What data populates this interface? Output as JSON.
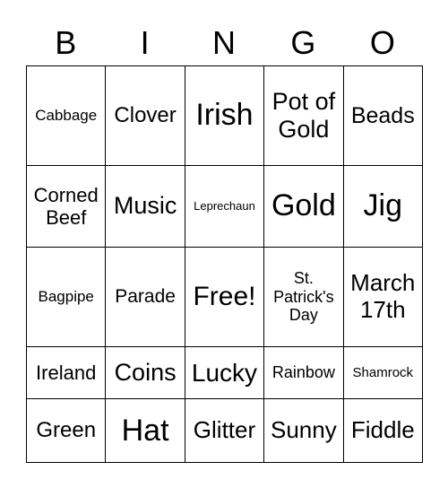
{
  "header": [
    "B",
    "I",
    "N",
    "G",
    "O"
  ],
  "cells": [
    [
      "Cabbage",
      "Clover",
      "Irish",
      "Pot of Gold",
      "Beads"
    ],
    [
      "Corned Beef",
      "Music",
      "Leprechaun",
      "Gold",
      "Jig"
    ],
    [
      "Bagpipe",
      "Parade",
      "Free!",
      "St. Patrick's Day",
      "March 17th"
    ],
    [
      "Ireland",
      "Coins",
      "Lucky",
      "Rainbow",
      "Shamrock"
    ],
    [
      "Green",
      "Hat",
      "Glitter",
      "Sunny",
      "Fiddle"
    ]
  ]
}
